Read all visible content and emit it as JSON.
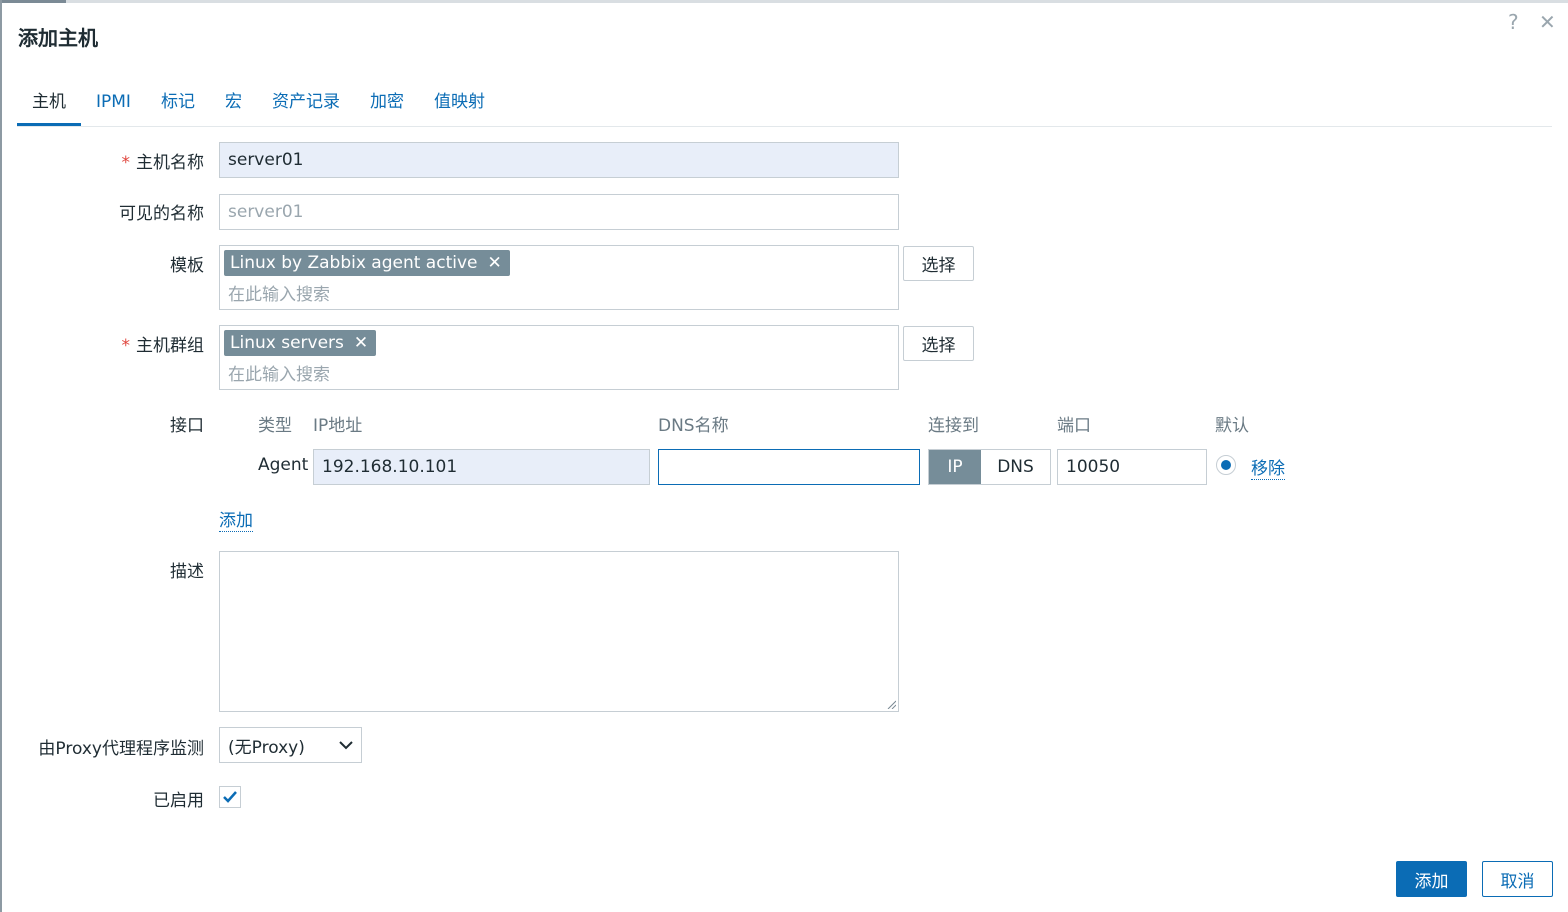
{
  "dialog": {
    "title": "添加主机",
    "help_icon": "?",
    "close_icon": "✕"
  },
  "tabs": [
    {
      "label": "主机",
      "active": true
    },
    {
      "label": "IPMI",
      "active": false
    },
    {
      "label": "标记",
      "active": false
    },
    {
      "label": "宏",
      "active": false
    },
    {
      "label": "资产记录",
      "active": false
    },
    {
      "label": "加密",
      "active": false
    },
    {
      "label": "值映射",
      "active": false
    }
  ],
  "form": {
    "host_name": {
      "label": "主机名称",
      "required_mark": "*",
      "value": "server01"
    },
    "visible_name": {
      "label": "可见的名称",
      "placeholder": "server01"
    },
    "templates": {
      "label": "模板",
      "tags": [
        "Linux by Zabbix agent active"
      ],
      "search_placeholder": "在此输入搜索",
      "select_label": "选择"
    },
    "host_groups": {
      "label": "主机群组",
      "required_mark": "*",
      "tags": [
        "Linux servers"
      ],
      "search_placeholder": "在此输入搜索",
      "select_label": "选择"
    },
    "interfaces": {
      "label": "接口",
      "columns": {
        "type": "类型",
        "ip": "IP地址",
        "dns": "DNS名称",
        "connect_to": "连接到",
        "port": "端口",
        "default": "默认"
      },
      "row": {
        "type": "Agent",
        "ip": "192.168.10.101",
        "dns": "",
        "connect_options": [
          "IP",
          "DNS"
        ],
        "connect_selected": "IP",
        "port": "10050",
        "default_selected": true,
        "remove_label": "移除"
      },
      "add_label": "添加"
    },
    "description": {
      "label": "描述",
      "value": ""
    },
    "proxy": {
      "label": "由Proxy代理程序监测",
      "selected": "(无Proxy)"
    },
    "enabled": {
      "label": "已启用",
      "checked": true
    }
  },
  "footer": {
    "add_label": "添加",
    "cancel_label": "取消"
  },
  "colors": {
    "accent": "#0b6cb5",
    "tag_bg": "#768d99",
    "required": "#e0463e"
  }
}
